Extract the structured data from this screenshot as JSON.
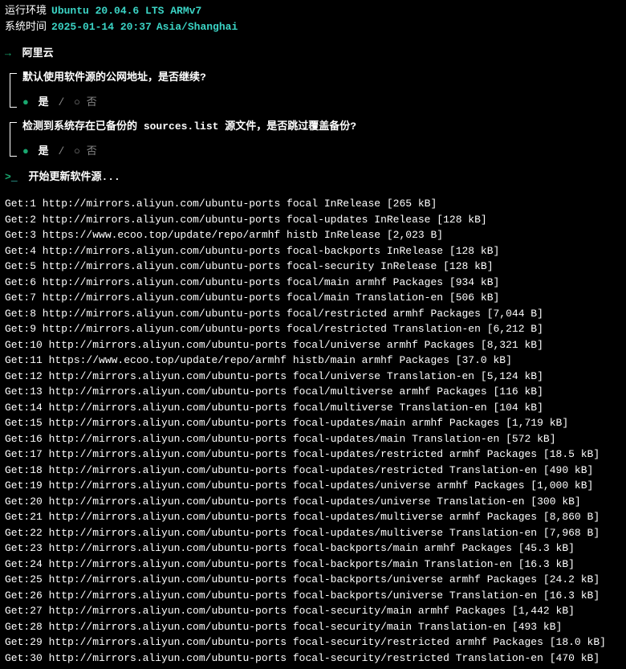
{
  "header": {
    "env_label": "运行环境",
    "env_value": "Ubuntu 20.04.6 LTS ARMv7",
    "time_label": "系统时间",
    "time_value": "2025-01-14 20:37",
    "time_tz": "Asia/Shanghai"
  },
  "provider": {
    "arrow": "→",
    "name": "阿里云"
  },
  "questions": [
    {
      "text_pre": "默认使用软件源的公网地址，是否继续?",
      "bold_mid": "",
      "text_post": "",
      "yes": "是",
      "no": "否"
    },
    {
      "text_pre": "检测到系统存在已备份的 ",
      "bold_mid": "sources.list",
      "text_post": " 源文件，是否跳过覆盖备份?",
      "yes": "是",
      "no": "否"
    }
  ],
  "start": {
    "prompt1": ">",
    "prompt2": "_",
    "text": "开始更新软件源..."
  },
  "get_lines": [
    "Get:1 http://mirrors.aliyun.com/ubuntu-ports focal InRelease [265 kB]",
    "Get:2 http://mirrors.aliyun.com/ubuntu-ports focal-updates InRelease [128 kB]",
    "Get:3 https://www.ecoo.top/update/repo/armhf histb InRelease [2,023 B]",
    "Get:4 http://mirrors.aliyun.com/ubuntu-ports focal-backports InRelease [128 kB]",
    "Get:5 http://mirrors.aliyun.com/ubuntu-ports focal-security InRelease [128 kB]",
    "Get:6 http://mirrors.aliyun.com/ubuntu-ports focal/main armhf Packages [934 kB]",
    "Get:7 http://mirrors.aliyun.com/ubuntu-ports focal/main Translation-en [506 kB]",
    "Get:8 http://mirrors.aliyun.com/ubuntu-ports focal/restricted armhf Packages [7,044 B]",
    "Get:9 http://mirrors.aliyun.com/ubuntu-ports focal/restricted Translation-en [6,212 B]",
    "Get:10 http://mirrors.aliyun.com/ubuntu-ports focal/universe armhf Packages [8,321 kB]",
    "Get:11 https://www.ecoo.top/update/repo/armhf histb/main armhf Packages [37.0 kB]",
    "Get:12 http://mirrors.aliyun.com/ubuntu-ports focal/universe Translation-en [5,124 kB]",
    "Get:13 http://mirrors.aliyun.com/ubuntu-ports focal/multiverse armhf Packages [116 kB]",
    "Get:14 http://mirrors.aliyun.com/ubuntu-ports focal/multiverse Translation-en [104 kB]",
    "Get:15 http://mirrors.aliyun.com/ubuntu-ports focal-updates/main armhf Packages [1,719 kB]",
    "Get:16 http://mirrors.aliyun.com/ubuntu-ports focal-updates/main Translation-en [572 kB]",
    "Get:17 http://mirrors.aliyun.com/ubuntu-ports focal-updates/restricted armhf Packages [18.5 kB]",
    "Get:18 http://mirrors.aliyun.com/ubuntu-ports focal-updates/restricted Translation-en [490 kB]",
    "Get:19 http://mirrors.aliyun.com/ubuntu-ports focal-updates/universe armhf Packages [1,000 kB]",
    "Get:20 http://mirrors.aliyun.com/ubuntu-ports focal-updates/universe Translation-en [300 kB]",
    "Get:21 http://mirrors.aliyun.com/ubuntu-ports focal-updates/multiverse armhf Packages [8,860 B]",
    "Get:22 http://mirrors.aliyun.com/ubuntu-ports focal-updates/multiverse Translation-en [7,968 B]",
    "Get:23 http://mirrors.aliyun.com/ubuntu-ports focal-backports/main armhf Packages [45.3 kB]",
    "Get:24 http://mirrors.aliyun.com/ubuntu-ports focal-backports/main Translation-en [16.3 kB]",
    "Get:25 http://mirrors.aliyun.com/ubuntu-ports focal-backports/universe armhf Packages [24.2 kB]",
    "Get:26 http://mirrors.aliyun.com/ubuntu-ports focal-backports/universe Translation-en [16.3 kB]",
    "Get:27 http://mirrors.aliyun.com/ubuntu-ports focal-security/main armhf Packages [1,442 kB]",
    "Get:28 http://mirrors.aliyun.com/ubuntu-ports focal-security/main Translation-en [493 kB]",
    "Get:29 http://mirrors.aliyun.com/ubuntu-ports focal-security/restricted armhf Packages [18.0 kB]",
    "Get:30 http://mirrors.aliyun.com/ubuntu-ports focal-security/restricted Translation-en [470 kB]"
  ]
}
